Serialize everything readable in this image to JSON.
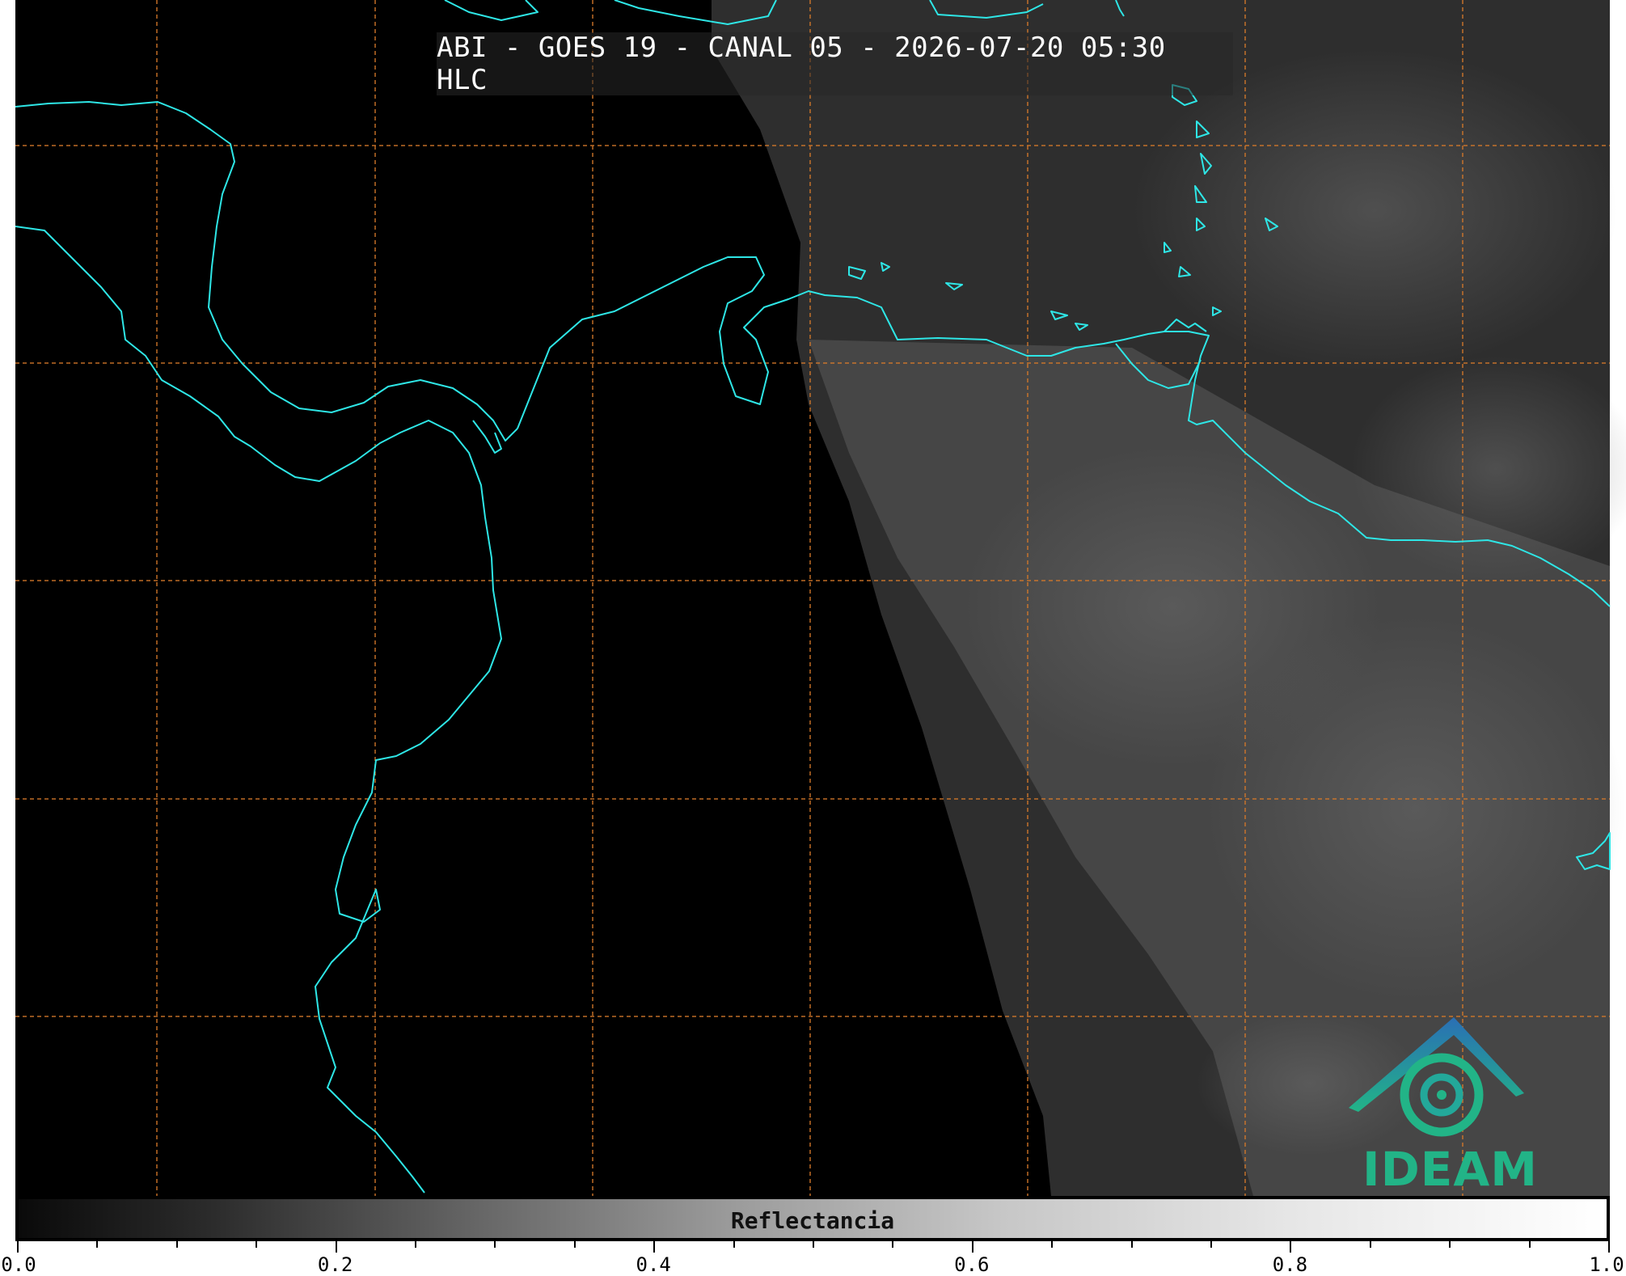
{
  "title": "ABI - GOES 19 - CANAL 05 - 2026-07-20 05:30 HLC",
  "colors": {
    "coastline": "#2ee6e6",
    "gridline": "#d4782a",
    "background": "#000000",
    "logo_blue": "#2a6fb5",
    "logo_teal": "#22b487"
  },
  "logo": {
    "text": "IDEAM",
    "icon": "ideam-logo-icon"
  },
  "colorbar": {
    "label": "Reflectancia",
    "range": [
      0.0,
      1.0
    ],
    "tick_labels": [
      "0.0",
      "0.2",
      "0.4",
      "0.6",
      "0.8",
      "1.0"
    ],
    "colormap": "grayscale"
  },
  "map": {
    "grid": true,
    "grid_style": "dashed"
  }
}
